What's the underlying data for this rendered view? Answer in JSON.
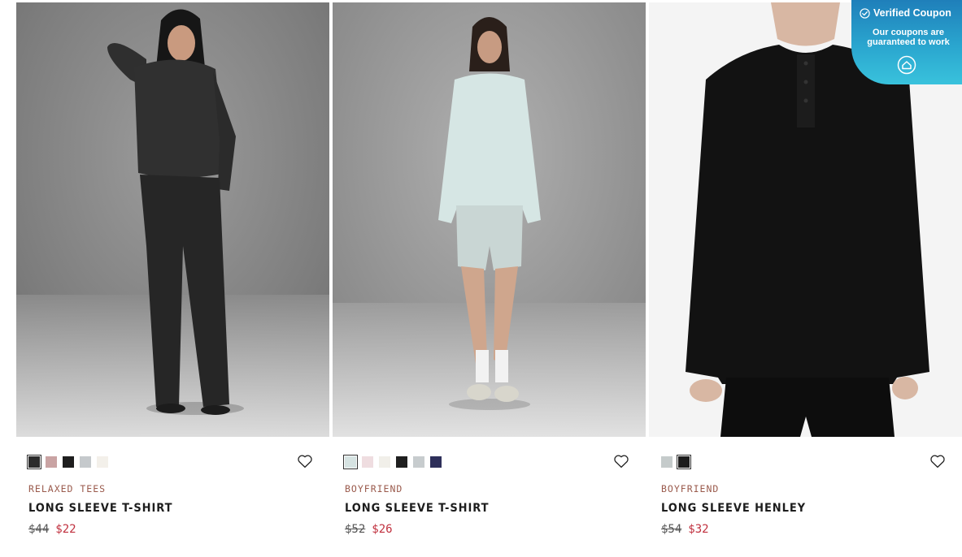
{
  "coupon": {
    "title": "Verified Coupon",
    "subtitle": "Our coupons are guaranteed to work"
  },
  "products": [
    {
      "collection": "RELAXED TEES",
      "name": "LONG SLEEVE T-SHIRT",
      "old_price": "$44",
      "price": "$22",
      "swatches": [
        "#2b2b2b",
        "#c9a3a3",
        "#1e1e1e",
        "#c5c9cc",
        "#f3f0ea"
      ],
      "selected_swatch": 0
    },
    {
      "collection": "BOYFRIEND",
      "name": "LONG SLEEVE T-SHIRT",
      "old_price": "$52",
      "price": "$26",
      "swatches": [
        "#d6e3e2",
        "#efdde0",
        "#f1efe9",
        "#1f1f1f",
        "#c7ccce",
        "#2e2f5a"
      ],
      "selected_swatch": 0
    },
    {
      "collection": "BOYFRIEND",
      "name": "LONG SLEEVE HENLEY",
      "old_price": "$54",
      "price": "$32",
      "swatches": [
        "#c5cbcb",
        "#1c1c1c"
      ],
      "selected_swatch": 1
    }
  ],
  "colors": {
    "sale_price": "#c0303e",
    "collection_label": "#9a5a4c",
    "coupon_gradient_start": "#1f7fba",
    "coupon_gradient_end": "#39c2dc"
  },
  "icons": {
    "wishlist": "heart-outline-icon",
    "coupon_check": "check-circle-icon",
    "coupon_logo": "house-logo-icon"
  }
}
